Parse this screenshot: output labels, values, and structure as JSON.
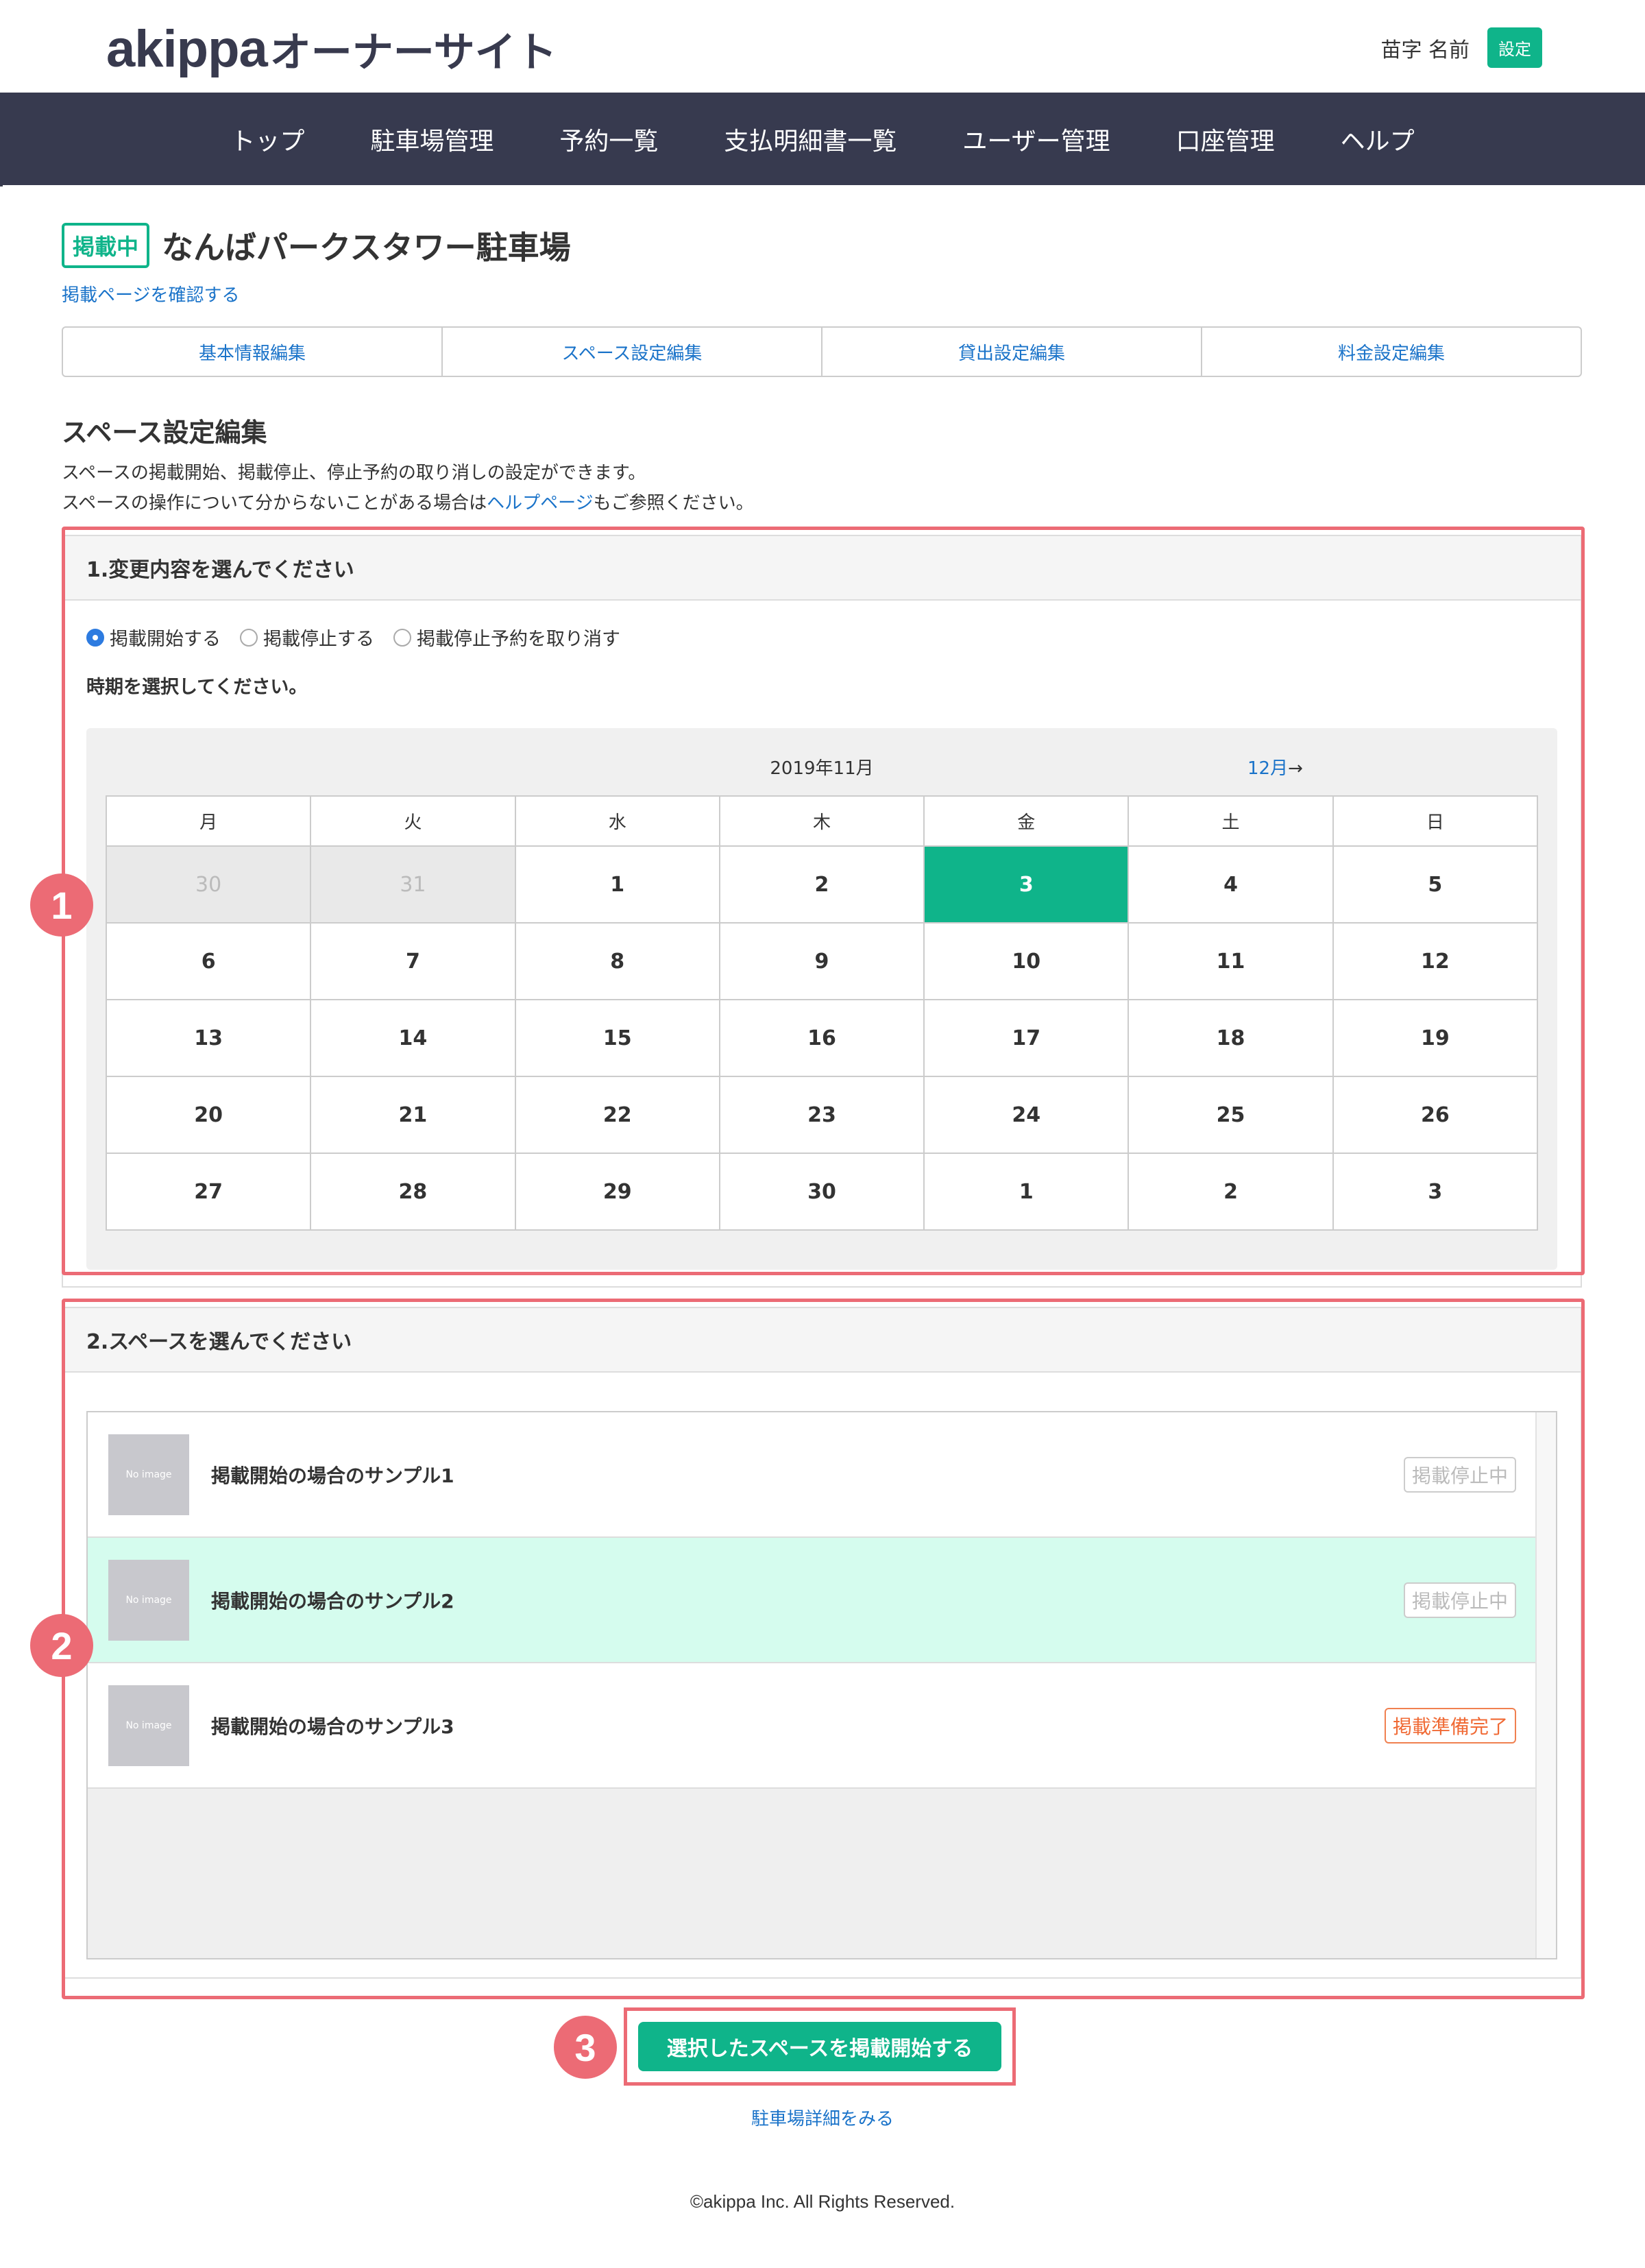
{
  "header": {
    "brand": "akippa",
    "brand_suffix": "オーナーサイト",
    "user_name": "苗字 名前",
    "settings_label": "設定"
  },
  "nav": {
    "items": [
      "トップ",
      "駐車場管理",
      "予約一覧",
      "支払明細書一覧",
      "ユーザー管理",
      "口座管理",
      "ヘルプ"
    ]
  },
  "page": {
    "status_badge": "掲載中",
    "title": "なんばパークスタワー駐車場",
    "check_link": "掲載ページを確認する"
  },
  "tabs": [
    "基本情報編集",
    "スペース設定編集",
    "貸出設定編集",
    "料金設定編集"
  ],
  "section": {
    "heading": "スペース設定編集",
    "desc_line1": "スペースの掲載開始、掲載停止、停止予約の取り消しの設定ができます。",
    "desc_line2_pre": "スペースの操作について分からないことがある場合は",
    "desc_line2_link": "ヘルプページ",
    "desc_line2_post": "もご参照ください。"
  },
  "step1": {
    "heading": "1.変更内容を選んでください",
    "options": [
      "掲載開始する",
      "掲載停止する",
      "掲載停止予約を取り消す"
    ],
    "selected_option": "掲載開始する",
    "period_label": "時期を選択してください。",
    "calendar": {
      "month": "2019年11月",
      "next_link": "12月",
      "next_arrow": "→",
      "weekdays": [
        "月",
        "火",
        "水",
        "木",
        "金",
        "土",
        "日"
      ],
      "weeks": [
        [
          "30",
          "31",
          "1",
          "2",
          "3",
          "4",
          "5"
        ],
        [
          "6",
          "7",
          "8",
          "9",
          "10",
          "11",
          "12"
        ],
        [
          "13",
          "14",
          "15",
          "16",
          "17",
          "18",
          "19"
        ],
        [
          "20",
          "21",
          "22",
          "23",
          "24",
          "25",
          "26"
        ],
        [
          "27",
          "28",
          "29",
          "30",
          "1",
          "2",
          "3"
        ]
      ],
      "selected_day": "3"
    }
  },
  "step2": {
    "heading": "2.スペースを選んでください",
    "spaces": [
      {
        "thumb": "No image",
        "name": "掲載開始の場合のサンプル1",
        "status": "掲載停止中"
      },
      {
        "thumb": "No image",
        "name": "掲載開始の場合のサンプル2",
        "status": "掲載停止中"
      },
      {
        "thumb": "No image",
        "name": "掲載開始の場合のサンプル3",
        "status": "掲載準備完了"
      }
    ]
  },
  "bubbles": [
    "1",
    "2",
    "3"
  ],
  "actions": {
    "submit": "選択したスペースを掲載開始する",
    "detail_link": "駐車場詳細をみる"
  },
  "footer": "©akippa Inc. All Rights Reserved.",
  "colors": {
    "brand_green": "#0fb48a",
    "nav_bg": "#373a4f",
    "link_blue": "#1a73c9",
    "highlight_red": "#ec6b75",
    "selected_row": "#d5fcee",
    "status_ready": "#f06a35"
  }
}
